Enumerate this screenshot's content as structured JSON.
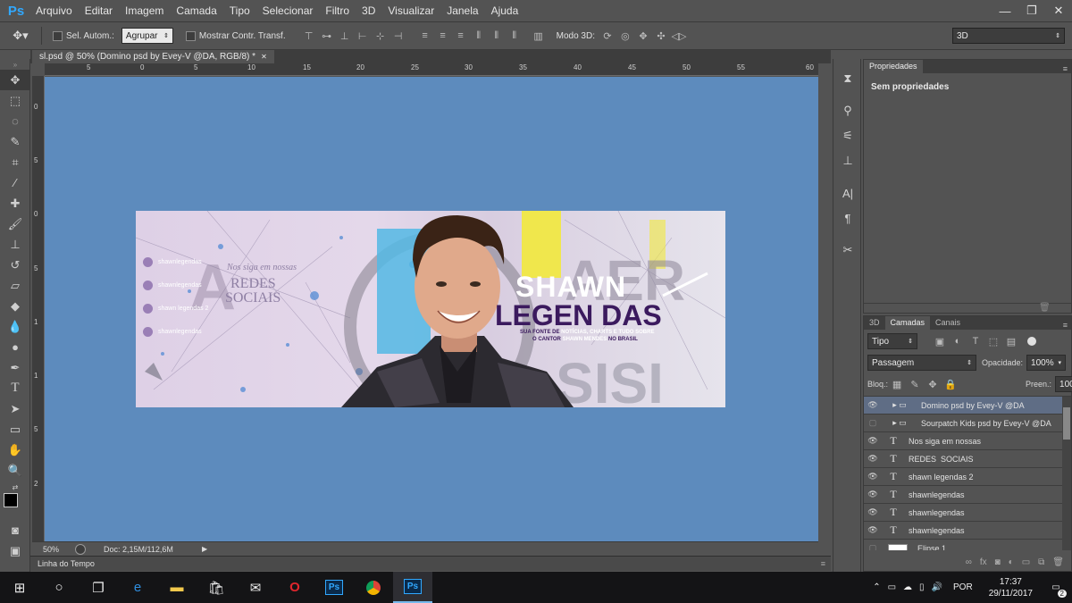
{
  "app": {
    "logo": "Ps",
    "menu": [
      "Arquivo",
      "Editar",
      "Imagem",
      "Camada",
      "Tipo",
      "Selecionar",
      "Filtro",
      "3D",
      "Visualizar",
      "Janela",
      "Ajuda"
    ]
  },
  "window_controls": {
    "minimize": "—",
    "restore": "❐",
    "close": "✕"
  },
  "options_bar": {
    "auto_select_label": "Sel. Autom.:",
    "group_value": "Agrupar",
    "show_transform_label": "Mostrar Contr. Transf.",
    "mode3d_label": "Modo 3D:",
    "workspace_value": "3D"
  },
  "document": {
    "tab_title": "sl.psd @ 50% (Domino psd by Evey-V @DA, RGB/8) *",
    "close_glyph": "✕",
    "zoom": "50%",
    "doc_info": "Doc: 2,15M/112,6M"
  },
  "rulers": {
    "top": [
      "5",
      "0",
      "5",
      "10",
      "15",
      "20",
      "25",
      "30",
      "35",
      "40",
      "45",
      "50",
      "55",
      "60"
    ],
    "left": [
      "0",
      "5",
      "0",
      "5",
      "1",
      "1",
      "5",
      "2"
    ]
  },
  "artwork": {
    "social_items": [
      "shawnlegendas",
      "shawnlegendas",
      "shawn legendas 2",
      "shawnlegendas"
    ],
    "follow_text": "Nos siga em nossas",
    "redes_text": "REDES",
    "sociais_text": "SOCIAIS",
    "title_line1": "SHAWN",
    "title_line2": "LEGEN DAS",
    "tagline_1a": "SUA FONTE DE",
    "tagline_1b": "NOTÍCIAS, CHARTS E TUDO SOBRE",
    "tagline_2a": "O CANTOR",
    "tagline_2b": "SHAWN MENDES",
    "tagline_2c": "NO BRASIL",
    "bg_letters_1": "A",
    "bg_letters_2": "SISI"
  },
  "timeline": {
    "label": "Linha do Tempo"
  },
  "properties": {
    "tab": "Propriedades",
    "message": "Sem propriedades"
  },
  "layers_panel": {
    "tabs": [
      "3D",
      "Camadas",
      "Canais"
    ],
    "kind_filter": "Tipo",
    "blend_mode": "Passagem",
    "opacity_label": "Opacidade:",
    "opacity_value": "100%",
    "lock_label": "Bloq.:",
    "fill_label": "Preen.:",
    "fill_value": "100%",
    "layers": [
      {
        "name": "Domino psd by Evey-V @DA",
        "type": "group",
        "visible": true,
        "selected": true
      },
      {
        "name": "Sourpatch Kids psd by Evey-V @DA",
        "type": "group",
        "visible": false,
        "selected": false
      },
      {
        "name": "Nos siga em nossas",
        "type": "text",
        "visible": true,
        "selected": false
      },
      {
        "name": "REDES  SOCIAIS",
        "type": "text",
        "visible": true,
        "selected": false
      },
      {
        "name": "shawn legendas 2",
        "type": "text",
        "visible": true,
        "selected": false
      },
      {
        "name": "shawnlegendas",
        "type": "text",
        "visible": true,
        "selected": false
      },
      {
        "name": "shawnlegendas",
        "type": "text",
        "visible": true,
        "selected": false
      },
      {
        "name": "shawnlegendas",
        "type": "text",
        "visible": true,
        "selected": false
      },
      {
        "name": "Elipse 1",
        "type": "shape",
        "visible": false,
        "selected": false
      }
    ],
    "footer_icons": [
      "link-icon",
      "fx-icon",
      "mask-icon",
      "adjustment-icon",
      "folder-icon",
      "new-layer-icon",
      "trash-icon"
    ]
  },
  "taskbar": {
    "language": "POR",
    "time": "17:37",
    "date": "29/11/2017",
    "notification_count": "2"
  },
  "colors": {
    "canvas_bg": "#5d8bbd",
    "panel_bg": "#535353",
    "purple_brand": "#3b1a5e",
    "selected_layer": "#5f6d85"
  }
}
